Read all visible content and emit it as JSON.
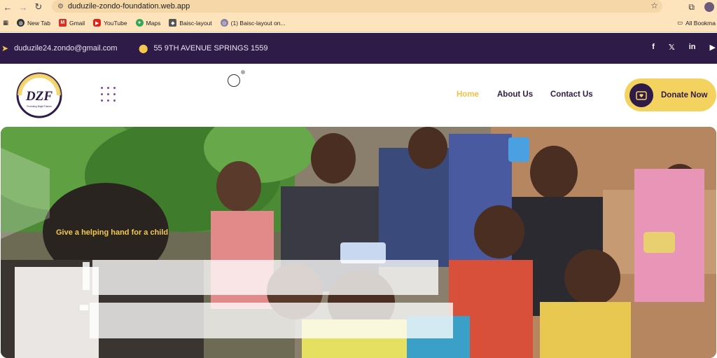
{
  "browser": {
    "url": "duduzile-zondo-foundation.web.app",
    "bookmarks": [
      {
        "label": "New Tab",
        "icon": "globe-icon"
      },
      {
        "label": "Gmail",
        "icon": "gmail-icon"
      },
      {
        "label": "YouTube",
        "icon": "youtube-icon"
      },
      {
        "label": "Maps",
        "icon": "maps-icon"
      },
      {
        "label": "Baisc-layout",
        "icon": "figma-icon"
      },
      {
        "label": "(1) Baisc-layout on...",
        "icon": "bookmark-icon"
      }
    ],
    "all_bookmarks": "All Bookma"
  },
  "topbar": {
    "email": "duduzile24.zondo@gmail.com",
    "address": "55 9TH AVENUE SPRINGS 1559",
    "socials": [
      "f",
      "𝕏",
      "in",
      "▶"
    ]
  },
  "nav": {
    "items": [
      {
        "label": "Home",
        "active": true
      },
      {
        "label": "About Us",
        "active": false
      },
      {
        "label": "Contact Us",
        "active": false
      }
    ],
    "donate_label": "Donate Now"
  },
  "logo": {
    "text": "DZF",
    "tagline": "Promoting Bright Futures"
  },
  "hero": {
    "tagline": "Give a helping hand for a child"
  },
  "colors": {
    "brand_purple": "#2f1b47",
    "brand_yellow": "#f4c84e",
    "chrome_bg": "#fde4bd"
  }
}
